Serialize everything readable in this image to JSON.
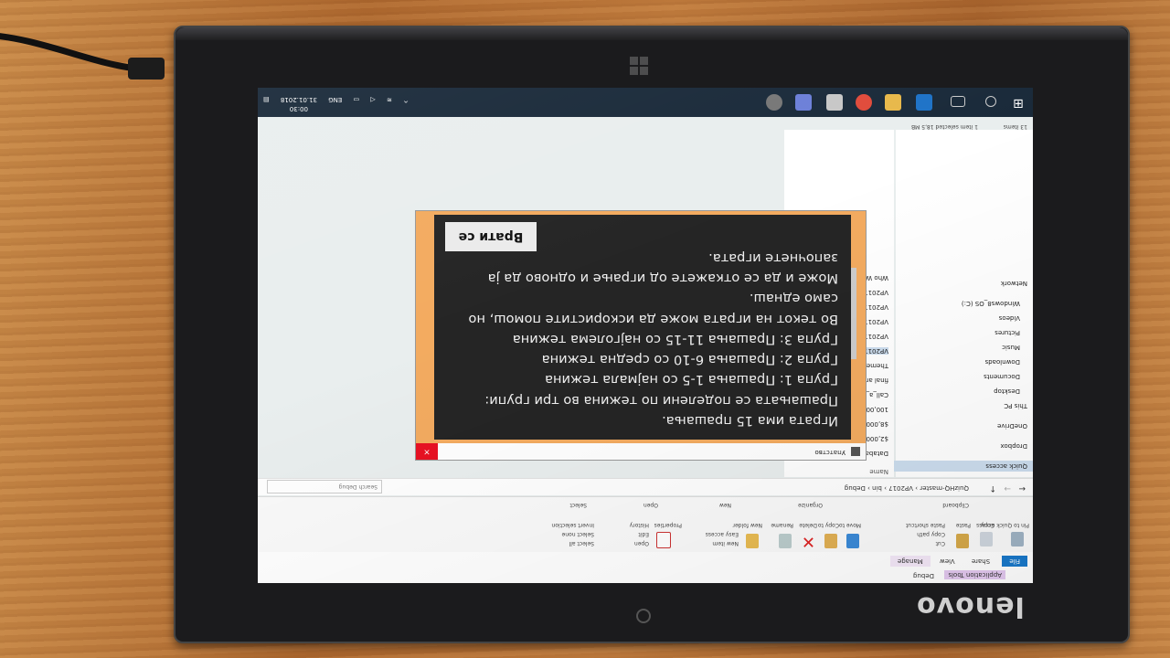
{
  "device": {
    "brand": "lenovo"
  },
  "colors": {
    "dialog_frame": "#f3ab60",
    "dialog_body": "#252525",
    "taskbar": "#1a2a3a",
    "file_tab": "#1979ca",
    "close_button": "#e81123"
  },
  "explorer": {
    "title_tab": "Application Tools",
    "title_path": "Debug",
    "tabs": [
      "File",
      "Home",
      "Share",
      "View",
      "Manage"
    ],
    "ribbon": {
      "clipboard": {
        "pin": "Pin to Quick access",
        "copy": "Copy",
        "paste": "Paste",
        "cut": "Cut",
        "copy_path": "Copy path",
        "paste_shortcut": "Paste shortcut",
        "group": "Clipboard"
      },
      "organize": {
        "move_to": "Move to",
        "copy_to": "Copy to",
        "delete": "Delete",
        "rename": "Rename",
        "group": "Organize"
      },
      "new": {
        "new_folder": "New folder",
        "new_item": "New item",
        "easy_access": "Easy access",
        "group": "New"
      },
      "open": {
        "properties": "Properties",
        "open": "Open",
        "edit": "Edit",
        "history": "History",
        "group": "Open"
      },
      "select": {
        "select_all": "Select all",
        "select_none": "Select none",
        "invert": "Invert selection",
        "group": "Select"
      }
    },
    "address": "QuizHQ-master  ›  VP2017  ›  bin  ›  Debug",
    "search_placeholder": "Search Debug",
    "nav": [
      "Quick access",
      "Dropbox",
      "OneDrive",
      "This PC",
      "Desktop",
      "Documents",
      "Downloads",
      "Music",
      "Pictures",
      "Videos",
      "Windows8_OS (C:)",
      "Network"
    ],
    "column_name": "Name",
    "files": [
      "Database",
      "$2,000 Lo",
      "$8,000 W",
      "100,000 V",
      "Call_a_frie",
      "final answ",
      "Theme Mu",
      "VP2017",
      "VP2017.ex",
      "VP2017.pc",
      "VP2017.vs",
      "VP2017.vs",
      "Who Wan"
    ],
    "status": {
      "items": "13 items",
      "selected": "1 item selected  18,5 MB"
    }
  },
  "taskbar": {
    "lang": "ENG",
    "time": "00:30",
    "date": "31.01.2018"
  },
  "dialog": {
    "title": "Упатство",
    "close": "×",
    "text": "Играта има 15 прашања.\nПрашањата се поделени по тежина во три групи:\nГрупа 1: Прашања 1-5 со најмала тежина\nГрупа 2: Прашања 6-10 со средна тежина\nГрупа 3: Прашања 11-15 со најголема тежина\nВо текот на играта може да искористите помош, но само еднаш.\nМоже и да се откажете од играње и одново да ја започнете играта.",
    "back_button": "Врати се"
  }
}
